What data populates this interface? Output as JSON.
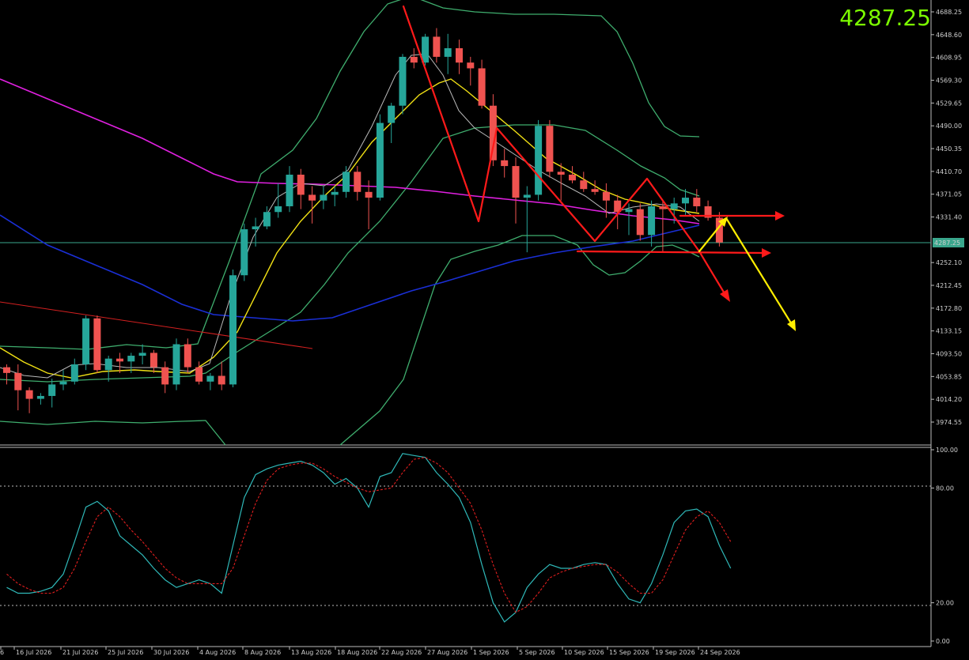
{
  "price_readout": "4287.25",
  "chart_data": {
    "type": "candlestick",
    "price_axis_ticks": [
      "4688.25",
      "4648.60",
      "4608.95",
      "4569.30",
      "4529.65",
      "4490.00",
      "4450.35",
      "4410.70",
      "4371.05",
      "4331.40",
      "4252.10",
      "4212.45",
      "4172.80",
      "4133.15",
      "4093.50",
      "4053.85",
      "4014.20",
      "3974.55"
    ],
    "current_price_tag": "4287.25",
    "ylim": [
      3955,
      4700
    ],
    "stoch_axis_ticks": [
      "100.00",
      "80.00",
      "20.00",
      "0.00"
    ],
    "stoch_ylim": [
      0,
      100
    ],
    "date_labels": [
      "6",
      "16 Jul 2026",
      "21 Jul 2026",
      "25 Jul 2026",
      "30 Jul 2026",
      "4 Aug 2026",
      "8 Aug 2026",
      "13 Aug 2026",
      "18 Aug 2026",
      "22 Aug 2026",
      "27 Aug 2026",
      "1 Sep 2026",
      "5 Sep 2026",
      "10 Sep 2026",
      "15 Sep 2026",
      "19 Sep 2026",
      "24 Sep 2026"
    ],
    "candles": [
      [
        4070,
        4075,
        4040,
        4060
      ],
      [
        4060,
        4075,
        3995,
        4030
      ],
      [
        4030,
        4035,
        3990,
        4015
      ],
      [
        4015,
        4025,
        4005,
        4020
      ],
      [
        4020,
        4050,
        4000,
        4040
      ],
      [
        4040,
        4065,
        4030,
        4045
      ],
      [
        4045,
        4085,
        4040,
        4075
      ],
      [
        4075,
        4160,
        4065,
        4155
      ],
      [
        4155,
        4160,
        4060,
        4065
      ],
      [
        4065,
        4090,
        4045,
        4085
      ],
      [
        4085,
        4095,
        4060,
        4080
      ],
      [
        4080,
        4095,
        4060,
        4090
      ],
      [
        4090,
        4110,
        4075,
        4095
      ],
      [
        4095,
        4100,
        4060,
        4070
      ],
      [
        4070,
        4080,
        4025,
        4040
      ],
      [
        4040,
        4120,
        4030,
        4110
      ],
      [
        4110,
        4120,
        4060,
        4070
      ],
      [
        4070,
        4080,
        4040,
        4045
      ],
      [
        4045,
        4060,
        4030,
        4055
      ],
      [
        4055,
        4080,
        4030,
        4040
      ],
      [
        4040,
        4240,
        4035,
        4230
      ],
      [
        4230,
        4320,
        4220,
        4310
      ],
      [
        4310,
        4330,
        4280,
        4315
      ],
      [
        4315,
        4350,
        4310,
        4340
      ],
      [
        4340,
        4390,
        4330,
        4350
      ],
      [
        4350,
        4420,
        4340,
        4405
      ],
      [
        4405,
        4415,
        4345,
        4370
      ],
      [
        4370,
        4385,
        4320,
        4360
      ],
      [
        4360,
        4385,
        4345,
        4370
      ],
      [
        4370,
        4385,
        4350,
        4375
      ],
      [
        4375,
        4420,
        4365,
        4410
      ],
      [
        4410,
        4420,
        4360,
        4375
      ],
      [
        4375,
        4395,
        4310,
        4365
      ],
      [
        4365,
        4510,
        4360,
        4495
      ],
      [
        4495,
        4530,
        4460,
        4525
      ],
      [
        4525,
        4615,
        4510,
        4610
      ],
      [
        4610,
        4625,
        4590,
        4600
      ],
      [
        4600,
        4650,
        4595,
        4645
      ],
      [
        4645,
        4660,
        4600,
        4610
      ],
      [
        4610,
        4650,
        4580,
        4625
      ],
      [
        4625,
        4640,
        4580,
        4600
      ],
      [
        4600,
        4610,
        4560,
        4590
      ],
      [
        4590,
        4605,
        4520,
        4525
      ],
      [
        4525,
        4545,
        4420,
        4430
      ],
      [
        4430,
        4450,
        4400,
        4420
      ],
      [
        4420,
        4435,
        4320,
        4365
      ],
      [
        4365,
        4385,
        4270,
        4370
      ],
      [
        4370,
        4500,
        4360,
        4490
      ],
      [
        4490,
        4500,
        4400,
        4410
      ],
      [
        4410,
        4425,
        4360,
        4405
      ],
      [
        4405,
        4420,
        4390,
        4395
      ],
      [
        4395,
        4410,
        4375,
        4380
      ],
      [
        4380,
        4395,
        4370,
        4375
      ],
      [
        4375,
        4390,
        4330,
        4360
      ],
      [
        4360,
        4370,
        4310,
        4340
      ],
      [
        4340,
        4355,
        4300,
        4345
      ],
      [
        4345,
        4355,
        4290,
        4300
      ],
      [
        4300,
        4360,
        4280,
        4350
      ],
      [
        4350,
        4360,
        4270,
        4345
      ],
      [
        4345,
        4365,
        4320,
        4355
      ],
      [
        4355,
        4380,
        4335,
        4365
      ],
      [
        4365,
        4380,
        4340,
        4350
      ],
      [
        4350,
        4360,
        4325,
        4330
      ],
      [
        4330,
        4340,
        4280,
        4287
      ]
    ],
    "stoch_main": [
      28,
      25,
      25,
      26,
      28,
      35,
      52,
      70,
      73,
      68,
      55,
      50,
      45,
      38,
      32,
      28,
      30,
      32,
      30,
      25,
      50,
      75,
      87,
      90,
      92,
      93,
      94,
      92,
      88,
      82,
      85,
      80,
      70,
      86,
      88,
      98,
      97,
      96,
      88,
      82,
      75,
      62,
      40,
      20,
      10,
      15,
      28,
      35,
      40,
      38,
      38,
      40,
      41,
      40,
      30,
      22,
      20,
      30,
      45,
      62,
      68,
      69,
      65,
      50,
      38
    ],
    "stoch_signal": [
      35,
      30,
      27,
      25,
      25,
      28,
      38,
      52,
      65,
      70,
      65,
      58,
      52,
      45,
      38,
      33,
      30,
      30,
      30,
      30,
      38,
      55,
      72,
      84,
      90,
      92,
      93,
      93,
      90,
      86,
      83,
      80,
      78,
      79,
      80,
      88,
      95,
      96,
      93,
      88,
      80,
      72,
      58,
      40,
      25,
      15,
      18,
      25,
      33,
      36,
      38,
      39,
      40,
      40,
      36,
      30,
      25,
      25,
      32,
      45,
      58,
      65,
      68,
      62,
      52
    ]
  }
}
